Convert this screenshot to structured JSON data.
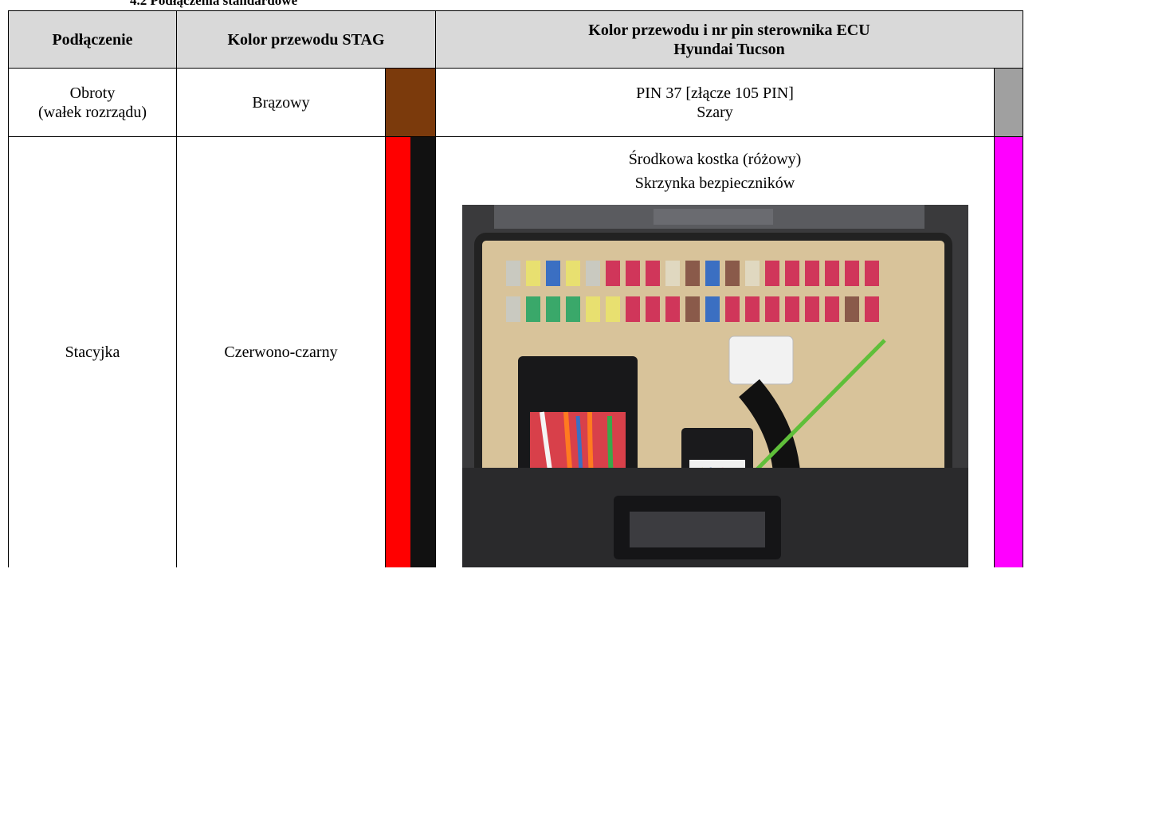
{
  "section_title": "4.2 Podłączenia standardowe",
  "headers": {
    "connection": "Podłączenie",
    "stag_color": "Kolor przewodu STAG",
    "ecu_line1": "Kolor przewodu i nr pin sterownika ECU",
    "ecu_line2": "Hyundai Tucson"
  },
  "rows": [
    {
      "connection_line1": "Obroty",
      "connection_line2": "(wałek rozrządu)",
      "stag_color": "Brązowy",
      "stag_swatch": [
        "#7b3a0c"
      ],
      "ecu_line1": "PIN 37 [złącze 105 PIN]",
      "ecu_line2": "Szary",
      "ecu_swatch": "#a0a0a0"
    },
    {
      "connection": "Stacyjka",
      "stag_color": "Czerwono-czarny",
      "stag_swatch": [
        "#ff0000",
        "#111111"
      ],
      "ecu_line1": "Środkowa kostka (różowy)",
      "ecu_line2": "Skrzynka bezpieczników",
      "ecu_swatch": "#ff00ff"
    }
  ],
  "colors": {
    "header_bg": "#d9d9d9",
    "arrow": "#5fbf3a"
  }
}
